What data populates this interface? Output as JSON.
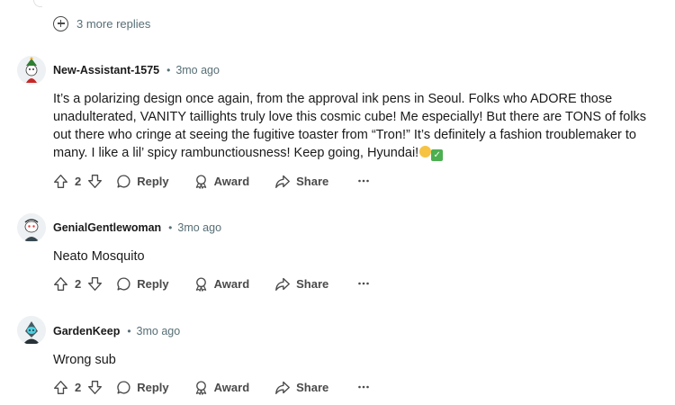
{
  "thread": {
    "more_replies": "3 more replies"
  },
  "comments": [
    {
      "username": "New-Assistant-1575",
      "age": "3mo ago",
      "body": "It’s a polarizing design once again, from the approval ink pens in Seoul. Folks who ADORE those unadulterated, VANITY taillights truly love this cosmic cube! Me especially! But there are TONS of folks out there who cringe at seeing the fugitive toaster from “Tron!” It’s definitely a fashion troublemaker to many. I like a lil’ spicy rambunctiousness! Keep going, Hyundai!",
      "votes": "2",
      "reply_label": "Reply",
      "award_label": "Award",
      "share_label": "Share"
    },
    {
      "username": "GenialGentlewoman",
      "age": "3mo ago",
      "body": "Neato Mosquito",
      "votes": "2",
      "reply_label": "Reply",
      "award_label": "Award",
      "share_label": "Share"
    },
    {
      "username": "GardenKeep",
      "age": "3mo ago",
      "body": "Wrong sub",
      "votes": "2",
      "reply_label": "Reply",
      "award_label": "Award",
      "share_label": "Share"
    }
  ],
  "icons": {
    "upvote": "arrow-up-icon",
    "downvote": "arrow-down-icon",
    "reply": "speech-bubble-icon",
    "award": "award-icon",
    "share": "share-arrow-icon",
    "more": "ellipsis-icon",
    "expand": "plus-circle-icon"
  },
  "colors": {
    "text": "#1a1a1b",
    "meta": "#576f76",
    "action": "#4a4a4a"
  }
}
